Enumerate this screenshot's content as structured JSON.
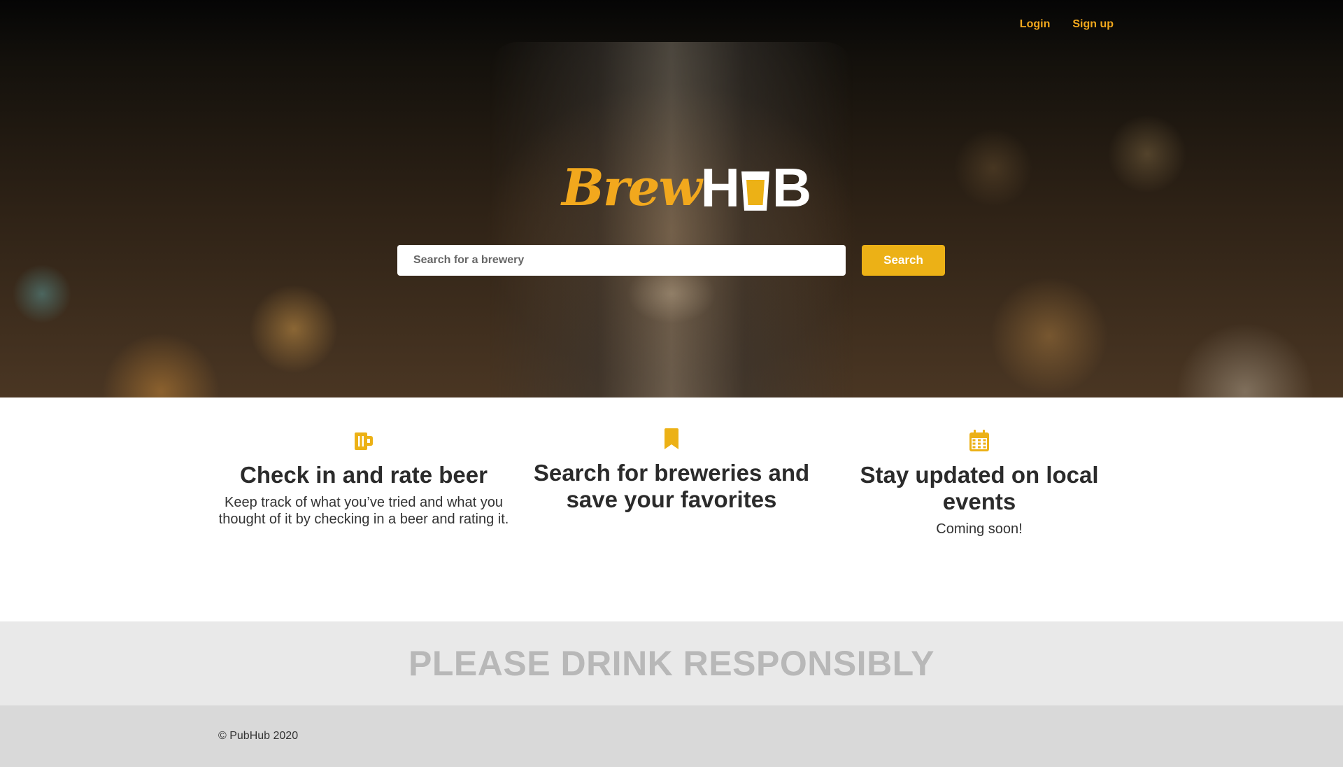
{
  "nav": {
    "login_label": "Login",
    "signup_label": "Sign up"
  },
  "logo": {
    "brew_text": "Brew",
    "hub_h": "H",
    "hub_b": "B",
    "cup_icon": "beer-glass-icon"
  },
  "search": {
    "placeholder": "Search for a brewery",
    "value": "",
    "button_label": "Search"
  },
  "features": [
    {
      "icon": "beer-mug-icon",
      "title": "Check in and rate beer",
      "description": "Keep track of what you’ve tried and what you thought of it by checking in a beer and rating it."
    },
    {
      "icon": "bookmark-icon",
      "title": "Search for breweries and save your favorites",
      "description": ""
    },
    {
      "icon": "calendar-icon",
      "title": "Stay updated on local events",
      "description": "Coming soon!"
    }
  ],
  "banner": {
    "text": "PLEASE DRINK RESPONSIBLY"
  },
  "footer": {
    "copyright": "© PubHub 2020"
  },
  "colors": {
    "accent": "#ecb116",
    "nav_link": "#f2a81d",
    "banner_bg": "#e9e9e9",
    "banner_text": "#b8b8b8",
    "footer_bg": "#d9d9d9"
  }
}
